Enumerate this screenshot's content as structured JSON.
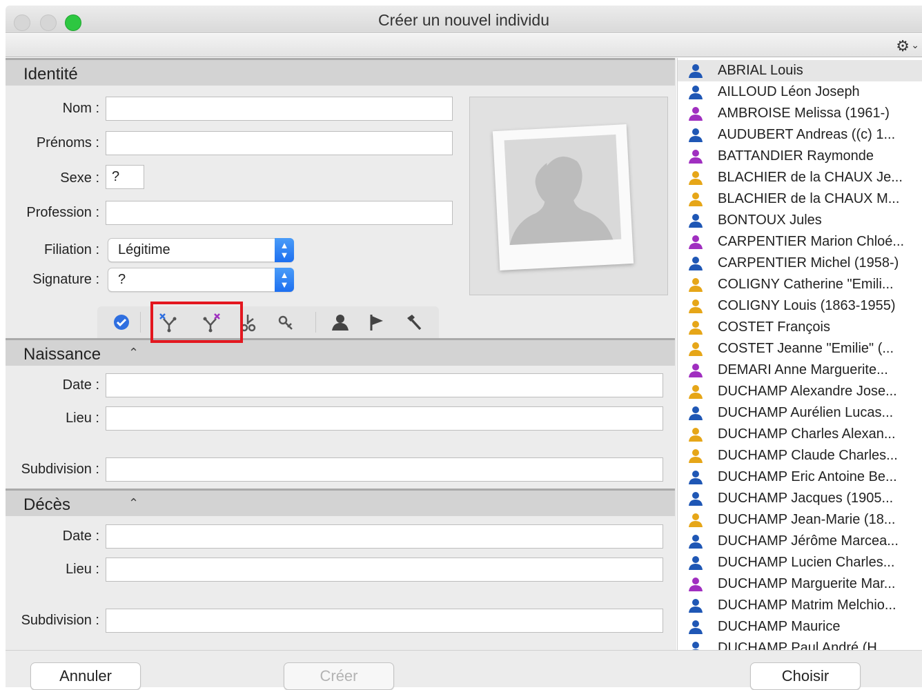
{
  "window": {
    "title": "Créer un nouvel individu"
  },
  "identity": {
    "header": "Identité",
    "nom_label": "Nom :",
    "nom_value": "",
    "prenoms_label": "Prénoms :",
    "prenoms_value": "",
    "sexe_label": "Sexe :",
    "sexe_value": "?",
    "profession_label": "Profession :",
    "profession_value": "",
    "filiation_label": "Filiation :",
    "filiation_value": "Légitime",
    "signature_label": "Signature :",
    "signature_value": "?"
  },
  "icon_bar": {
    "icons": [
      "check-icon",
      "link-father-icon",
      "link-mother-icon",
      "scissors-icon",
      "unlink-icon",
      "person-icon",
      "flag-icon",
      "hammer-icon"
    ],
    "highlight_color": "#e3171f"
  },
  "naissance": {
    "header": "Naissance",
    "date_label": "Date :",
    "lieu_label": "Lieu :",
    "subdivision_label": "Subdivision :"
  },
  "deces": {
    "header": "Décès",
    "date_label": "Date :",
    "lieu_label": "Lieu :",
    "subdivision_label": "Subdivision :"
  },
  "people": [
    {
      "name": "ABRIAL Louis",
      "sex": "male",
      "selected": true
    },
    {
      "name": "AILLOUD Léon Joseph",
      "sex": "male"
    },
    {
      "name": "AMBROISE Melissa (1961-)",
      "sex": "female"
    },
    {
      "name": "AUDUBERT Andreas ((c) 1...",
      "sex": "male"
    },
    {
      "name": "BATTANDIER Raymonde",
      "sex": "female"
    },
    {
      "name": "BLACHIER de la CHAUX Je...",
      "sex": "unknown"
    },
    {
      "name": "BLACHIER de la CHAUX M...",
      "sex": "unknown"
    },
    {
      "name": "BONTOUX Jules",
      "sex": "male"
    },
    {
      "name": "CARPENTIER Marion Chloé...",
      "sex": "female"
    },
    {
      "name": "CARPENTIER Michel (1958-)",
      "sex": "male"
    },
    {
      "name": "COLIGNY Catherine \"Emili...",
      "sex": "unknown"
    },
    {
      "name": "COLIGNY Louis (1863-1955)",
      "sex": "unknown"
    },
    {
      "name": "COSTET François",
      "sex": "unknown"
    },
    {
      "name": "COSTET Jeanne \"Emilie\" (...",
      "sex": "unknown"
    },
    {
      "name": "DEMARI Anne Marguerite...",
      "sex": "female"
    },
    {
      "name": "DUCHAMP Alexandre Jose...",
      "sex": "unknown"
    },
    {
      "name": "DUCHAMP Aurélien Lucas...",
      "sex": "male"
    },
    {
      "name": "DUCHAMP Charles Alexan...",
      "sex": "unknown"
    },
    {
      "name": "DUCHAMP Claude Charles...",
      "sex": "unknown"
    },
    {
      "name": "DUCHAMP Eric Antoine Be...",
      "sex": "male"
    },
    {
      "name": "DUCHAMP Jacques (1905...",
      "sex": "male"
    },
    {
      "name": "DUCHAMP Jean-Marie (18...",
      "sex": "unknown"
    },
    {
      "name": "DUCHAMP Jérôme Marcea...",
      "sex": "male"
    },
    {
      "name": "DUCHAMP Lucien Charles...",
      "sex": "male"
    },
    {
      "name": "DUCHAMP Marguerite Mar...",
      "sex": "female"
    },
    {
      "name": "DUCHAMP Matrim Melchio...",
      "sex": "male"
    },
    {
      "name": "DUCHAMP Maurice",
      "sex": "male"
    },
    {
      "name": "DUCHAMP Paul André (H...",
      "sex": "male"
    }
  ],
  "sex_colors": {
    "male": "#1f57b5",
    "female": "#a02fc0",
    "unknown": "#e6a618"
  },
  "footer": {
    "cancel_label": "Annuler",
    "create_label": "Créer",
    "choose_label": "Choisir"
  }
}
